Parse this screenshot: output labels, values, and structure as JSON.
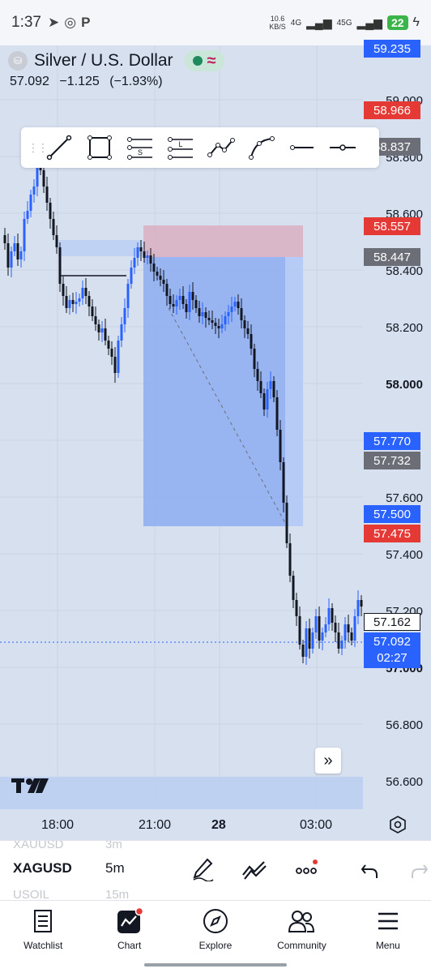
{
  "status_bar": {
    "time": "1:37",
    "net_speed": "10.6",
    "net_unit": "KB/S",
    "net_4g": "4G",
    "net_45g": "45G",
    "battery": "22"
  },
  "header": {
    "title": "Silver / U.S. Dollar",
    "last_price": "57.092",
    "change": "−1.125",
    "change_pct": "(−1.93%)"
  },
  "price_axis": {
    "labels": [
      "59.000",
      "58.800",
      "58.600",
      "58.400",
      "58.200",
      "58.000",
      "57.600",
      "57.400",
      "57.200",
      "57.000",
      "56.800",
      "56.600"
    ],
    "tags": {
      "t59235": "59.235",
      "t58966": "58.966",
      "t58837": "58.837",
      "t58557": "58.557",
      "t58447": "58.447",
      "t57770": "57.770",
      "t57732": "57.732",
      "t57500": "57.500",
      "t57475": "57.475",
      "t57162": "57.162",
      "current_price": "57.092",
      "countdown": "02:27"
    }
  },
  "time_axis": {
    "labels": [
      "18:00",
      "21:00",
      "28",
      "03:00"
    ]
  },
  "bottom_toolbar": {
    "faded_top_symbol": "XAUUSD",
    "faded_top_interval": "3m",
    "symbol": "XAGUSD",
    "interval": "5m",
    "faded_bottom_symbol": "USOIL",
    "faded_bottom_interval": "15m"
  },
  "nav": {
    "watchlist": "Watchlist",
    "chart": "Chart",
    "explore": "Explore",
    "community": "Community",
    "menu": "Menu"
  },
  "colors": {
    "up": "#2962ff",
    "down": "#131722",
    "accent": "#2962ff",
    "danger": "#e53935",
    "background": "#d6e0ee"
  }
}
